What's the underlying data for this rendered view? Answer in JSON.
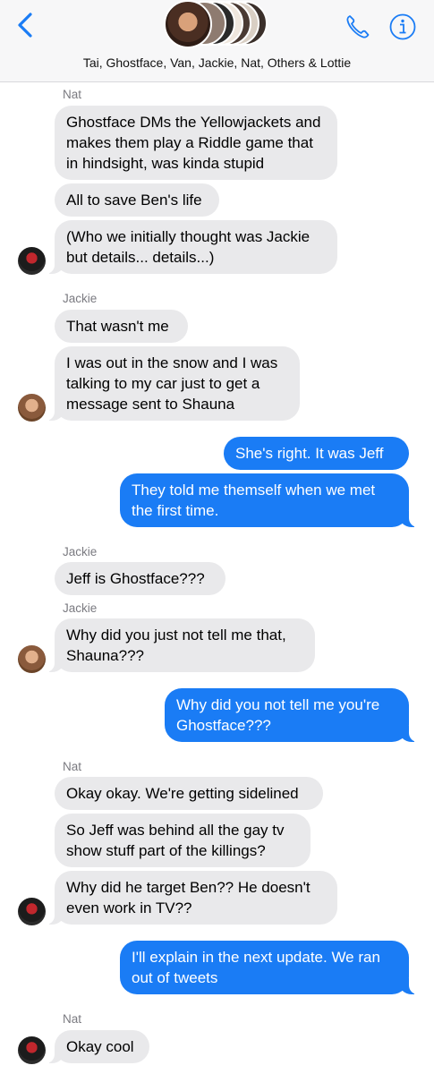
{
  "header": {
    "group_name": "Tai, Ghostface, Van, Jackie, Nat, Others & Lottie",
    "back_icon": "chevron-left-icon",
    "call_icon": "phone-icon",
    "info_icon": "info-icon",
    "accent_color": "#1a7cf5"
  },
  "messages": [
    {
      "sender": "Nat"
    },
    {
      "text": "Ghostface DMs the Yellowjackets and makes them play a Riddle game that in hindsight, was kinda stupid"
    },
    {
      "text": "All to save Ben's life"
    },
    {
      "text": "(Who we initially thought was Jackie but details... details...)"
    },
    {
      "sender": "Jackie"
    },
    {
      "text": "That wasn't me"
    },
    {
      "text": "I was out in the snow and I was talking to my car just to get a message sent to Shauna"
    },
    {
      "text": "She's right. It was Jeff"
    },
    {
      "text": "They told me themself when we met the first time."
    },
    {
      "sender": "Jackie"
    },
    {
      "text": "Jeff is Ghostface???"
    },
    {
      "sender": "Jackie"
    },
    {
      "text": "Why did you just not tell me that, Shauna???"
    },
    {
      "text": "Why did you not tell me you're Ghostface???"
    },
    {
      "sender": "Nat"
    },
    {
      "text": "Okay okay. We're getting sidelined"
    },
    {
      "text": "So Jeff was behind all the gay tv show stuff part of the killings?"
    },
    {
      "text": "Why did he target Ben?? He doesn't even work in TV??"
    },
    {
      "text": "I'll explain in the next update. We ran out of tweets"
    },
    {
      "sender": "Nat"
    },
    {
      "text": "Okay cool"
    }
  ]
}
